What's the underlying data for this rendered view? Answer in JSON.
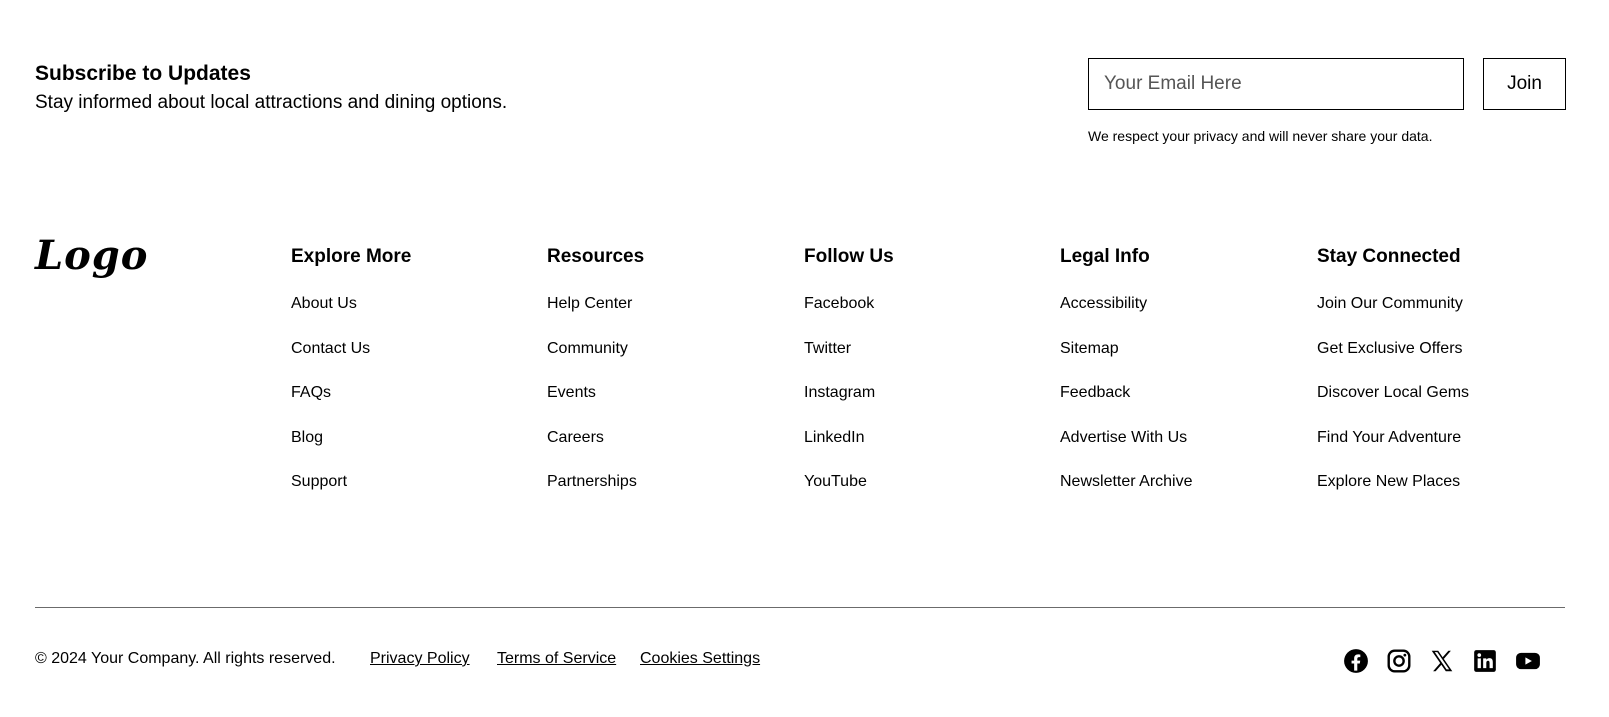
{
  "newsletter": {
    "title": "Subscribe to Updates",
    "subtitle": "Stay informed about local attractions and dining options.",
    "email_placeholder": "Your Email Here",
    "email_value": "",
    "join_label": "Join",
    "privacy_note": "We respect your privacy and will never share your data."
  },
  "logo": {
    "text": "Logo"
  },
  "columns": [
    {
      "heading": "Explore More",
      "links": [
        "About Us",
        "Contact Us",
        "FAQs",
        "Blog",
        "Support"
      ]
    },
    {
      "heading": "Resources",
      "links": [
        "Help Center",
        "Community",
        "Events",
        "Careers",
        "Partnerships"
      ]
    },
    {
      "heading": "Follow Us",
      "links": [
        "Facebook",
        "Twitter",
        "Instagram",
        "LinkedIn",
        "YouTube"
      ]
    },
    {
      "heading": "Legal Info",
      "links": [
        "Accessibility",
        "Sitemap",
        "Feedback",
        "Advertise With Us",
        "Newsletter Archive"
      ]
    },
    {
      "heading": "Stay Connected",
      "links": [
        "Join Our Community",
        "Get Exclusive Offers",
        "Discover Local Gems",
        "Find Your Adventure",
        "Explore New Places"
      ]
    }
  ],
  "bottom": {
    "copyright": "© 2024 Your Company. All rights reserved.",
    "legal_links": [
      "Privacy Policy",
      "Terms of Service",
      "Cookies Settings"
    ],
    "social_icons": [
      "facebook-icon",
      "instagram-icon",
      "x-icon",
      "linkedin-icon",
      "youtube-icon"
    ]
  },
  "colors": {
    "text": "#000000",
    "background": "#ffffff",
    "divider": "#6b6b6b"
  }
}
